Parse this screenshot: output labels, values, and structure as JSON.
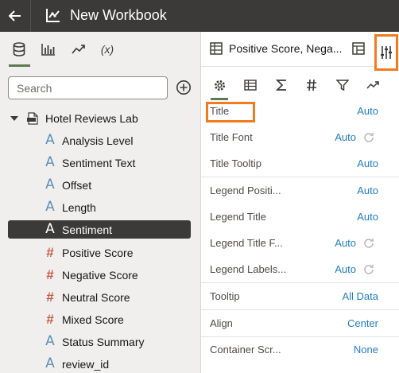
{
  "topbar": {
    "title": "New Workbook"
  },
  "left_panel": {
    "tabs": [
      "data-tab",
      "visualizations-tab",
      "analytics-tab",
      "calculations-tab"
    ],
    "calc_tab_label": "(x)",
    "search": {
      "placeholder": "Search",
      "value": ""
    },
    "dataset": {
      "name": "Hotel Reviews Lab"
    },
    "fields": [
      {
        "label": "Analysis Level",
        "type": "text",
        "icon": "A"
      },
      {
        "label": "Sentiment Text",
        "type": "text",
        "icon": "A"
      },
      {
        "label": "Offset",
        "type": "text",
        "icon": "A"
      },
      {
        "label": "Length",
        "type": "text",
        "icon": "A"
      },
      {
        "label": "Sentiment",
        "type": "text",
        "icon": "A",
        "selected": true
      },
      {
        "label": "Positive Score",
        "type": "num",
        "icon": "#"
      },
      {
        "label": "Negative Score",
        "type": "num",
        "icon": "#"
      },
      {
        "label": "Neutral Score",
        "type": "num",
        "icon": "#"
      },
      {
        "label": "Mixed Score",
        "type": "num",
        "icon": "#"
      },
      {
        "label": "Status Summary",
        "type": "text",
        "icon": "A"
      },
      {
        "label": "review_id",
        "type": "text",
        "icon": "A"
      }
    ]
  },
  "right_panel": {
    "viz_name": "Positive Score, Nega...",
    "properties": [
      {
        "name": "Title",
        "value": "Auto",
        "refresh": false
      },
      {
        "name": "Title Font",
        "value": "Auto",
        "refresh": true
      },
      {
        "name": "Title Tooltip",
        "value": "Auto",
        "refresh": false
      },
      {
        "name": "Legend Positi...",
        "value": "Auto",
        "refresh": false
      },
      {
        "name": "Legend Title",
        "value": "Auto",
        "refresh": false
      },
      {
        "name": "Legend Title F...",
        "value": "Auto",
        "refresh": true
      },
      {
        "name": "Legend Labels...",
        "value": "Auto",
        "refresh": true
      },
      {
        "name": "Tooltip",
        "value": "All Data",
        "refresh": false
      },
      {
        "name": "Align",
        "value": "Center",
        "refresh": false
      },
      {
        "name": "Container Scr...",
        "value": "None",
        "refresh": false
      }
    ]
  },
  "colors": {
    "topbar": "#3b3a38",
    "accent": "#5c7a53",
    "highlight": "#f47a20",
    "link": "#227dc5"
  }
}
